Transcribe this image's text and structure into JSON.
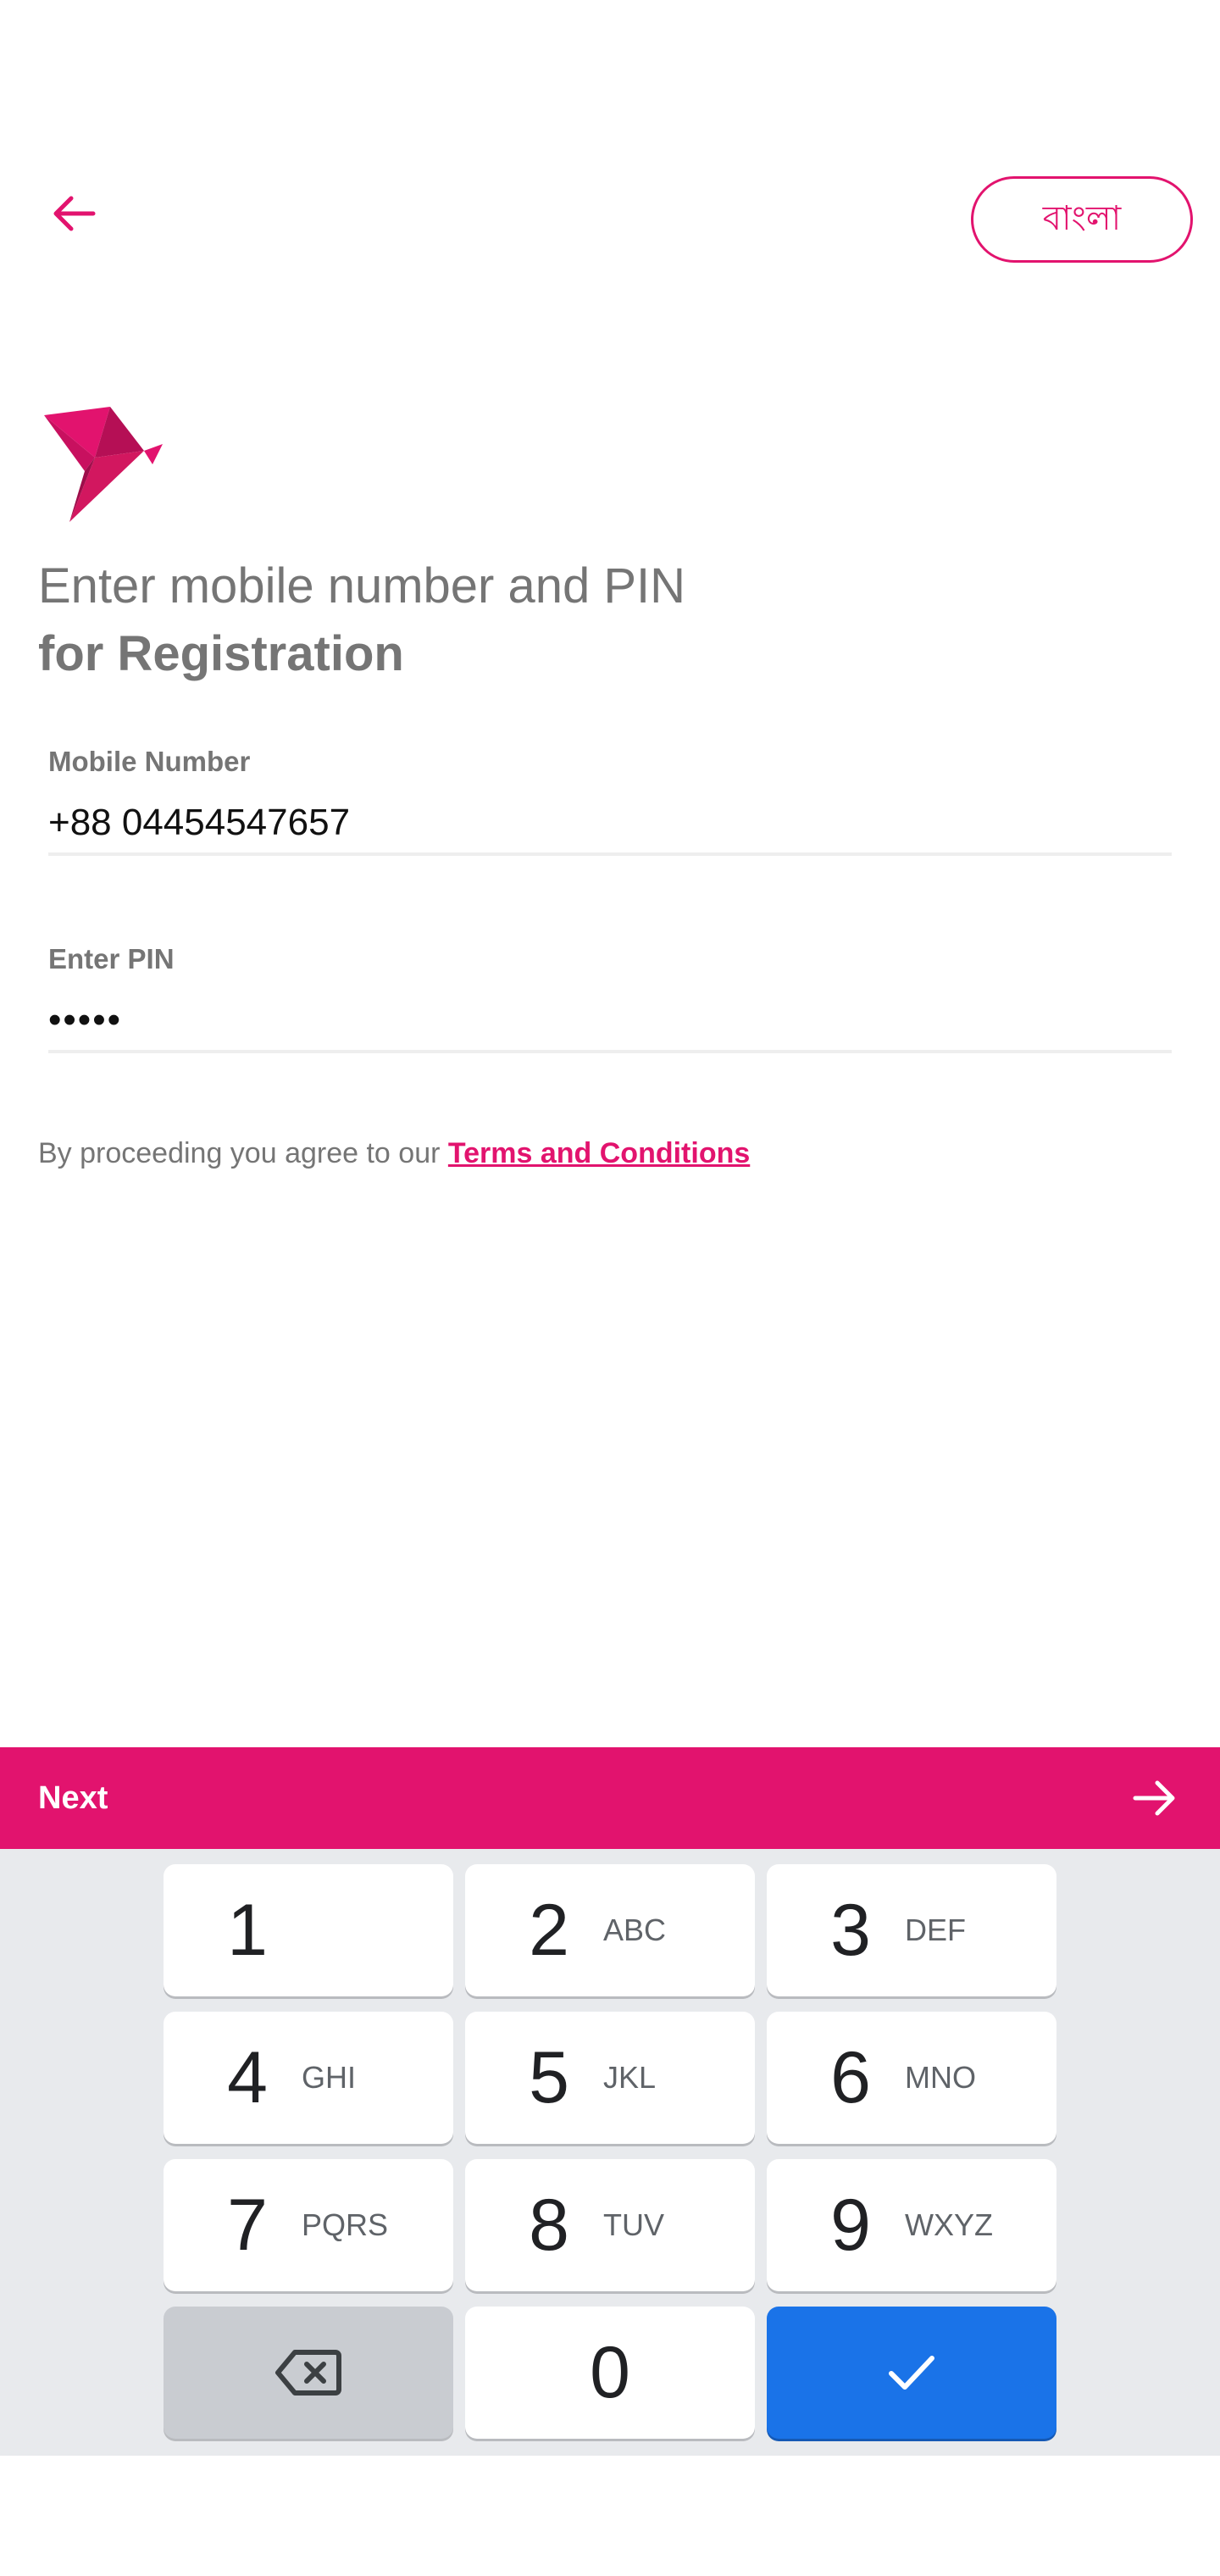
{
  "header": {
    "back_icon": "arrow-left-icon",
    "language_button_label": "বাংলা",
    "accent_color": "#e2136e"
  },
  "logo": {
    "icon": "origami-bird-logo"
  },
  "heading": {
    "line1": "Enter mobile number and PIN",
    "line2": "for Registration"
  },
  "fields": {
    "mobile": {
      "label": "Mobile Number",
      "value": "+88 04454547657"
    },
    "pin": {
      "label": "Enter PIN",
      "value": "•••••"
    }
  },
  "terms": {
    "prefix": "By proceeding you agree to our ",
    "link": "Terms and Conditions"
  },
  "next_bar": {
    "label": "Next",
    "icon": "arrow-right-icon"
  },
  "keyboard": {
    "keys": [
      {
        "digit": "1",
        "letters": ""
      },
      {
        "digit": "2",
        "letters": "ABC"
      },
      {
        "digit": "3",
        "letters": "DEF"
      },
      {
        "digit": "4",
        "letters": "GHI"
      },
      {
        "digit": "5",
        "letters": "JKL"
      },
      {
        "digit": "6",
        "letters": "MNO"
      },
      {
        "digit": "7",
        "letters": "PQRS"
      },
      {
        "digit": "8",
        "letters": "TUV"
      },
      {
        "digit": "9",
        "letters": "WXYZ"
      },
      {
        "digit": "0",
        "letters": ""
      }
    ],
    "delete_icon": "backspace-icon",
    "done_icon": "checkmark-icon",
    "done_color": "#1a73e8"
  }
}
